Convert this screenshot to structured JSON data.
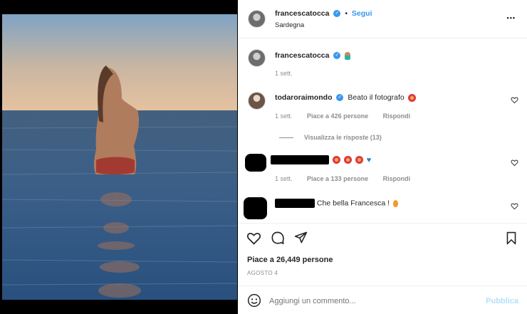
{
  "post": {
    "author": "francescatocca",
    "follow_label": "Segui",
    "location": "Sardegna",
    "more_label": "•••"
  },
  "caption": {
    "author": "francescatocca",
    "time": "1 sett."
  },
  "comments": [
    {
      "author": "todaroraimondo",
      "text": "Beato il fotografo",
      "time": "1 sett.",
      "likes": "Piace a 426 persone",
      "reply": "Rispondi",
      "replies": "Visualizza le risposte (13)"
    },
    {
      "time": "1 sett.",
      "likes": "Piace a 133 persone",
      "reply": "Rispondi"
    },
    {
      "text": "Che bella Francesca !"
    }
  ],
  "actions": {
    "likes_total": "Piace a 26,449 persone",
    "date": "AGOSTO 4"
  },
  "composer": {
    "placeholder": "Aggiungi un commento...",
    "publish_label": "Pubblica"
  },
  "colors": {
    "accent": "#3897f0",
    "publish_disabled": "#b2dffc",
    "verified": "#3897f0"
  }
}
